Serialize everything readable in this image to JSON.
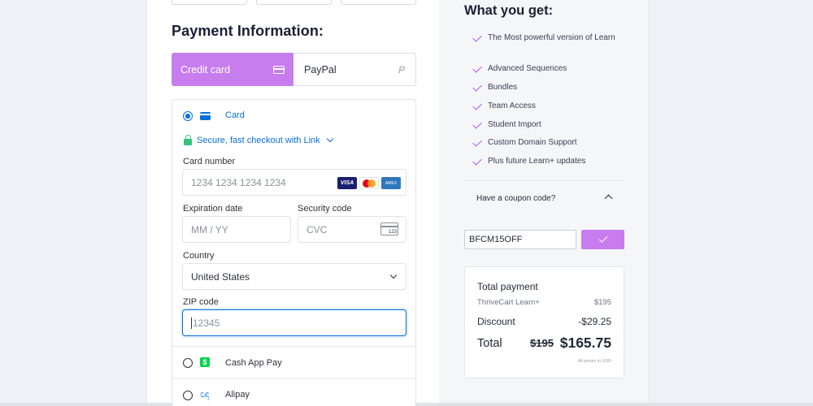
{
  "payment": {
    "title": "Payment Information:",
    "tabs": {
      "credit_label": "Credit card",
      "paypal_label": "PayPal"
    },
    "stripe": {
      "card_option_label": "Card",
      "link_label": "Secure, fast checkout with Link",
      "card_number_label": "Card number",
      "card_number_placeholder": "1234 1234 1234 1234",
      "brand_visa": "VISA",
      "brand_amex": "AMEX",
      "expiry_label": "Expiration date",
      "expiry_placeholder": "MM / YY",
      "cvc_label": "Security code",
      "cvc_placeholder": "CVC",
      "cvc_icon_text": "123",
      "country_label": "Country",
      "country_value": "United States",
      "zip_label": "ZIP code",
      "zip_placeholder": "12345",
      "cashapp_label": "Cash App Pay",
      "cashapp_icon": "$",
      "alipay_label": "Alipay"
    }
  },
  "benefits": {
    "title": "What you get:",
    "items": [
      "The Most powerful version of Learn",
      "Advanced Sequences",
      "Bundles",
      "Team Access",
      "Student Import",
      "Custom Domain Support",
      "Plus future Learn+ updates"
    ]
  },
  "coupon": {
    "question": "Have a coupon code?",
    "value": "BFCM15OFF"
  },
  "summary": {
    "title": "Total payment",
    "product_name": "ThriveCart Learn+",
    "product_price": "$195",
    "discount_label": "Discount",
    "discount_value": "-$29.25",
    "total_label": "Total",
    "old_price": "$195",
    "new_price": "$165.75",
    "note": "All prices in USD"
  },
  "colors": {
    "accent_purple": "#c77dee",
    "stripe_blue": "#0570de",
    "link_green": "#33c27f"
  },
  "icons": {
    "credit_tab": "credit-card-icon",
    "paypal_tab": "paypal-icon",
    "check": "check-icon",
    "chevron": "chevron-icon"
  }
}
